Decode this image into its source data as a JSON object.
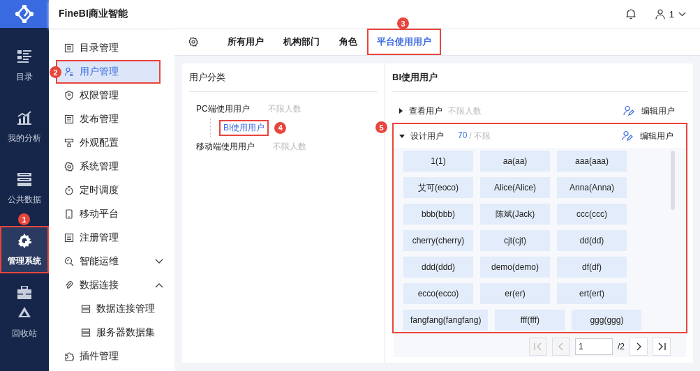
{
  "header": {
    "title": "FineBI商业智能",
    "user": "1"
  },
  "rail": [
    {
      "label": "目录",
      "selected": false
    },
    {
      "label": "我的分析",
      "selected": false
    },
    {
      "label": "公共数据",
      "selected": false
    },
    {
      "label": "管理系统",
      "selected": true,
      "callout": "1"
    },
    {
      "label": "回收站",
      "selected": false
    }
  ],
  "menu": [
    {
      "label": "目录管理",
      "selected": false
    },
    {
      "label": "用户管理",
      "selected": true,
      "callout": "2"
    },
    {
      "label": "权限管理",
      "selected": false
    },
    {
      "label": "发布管理",
      "selected": false
    },
    {
      "label": "外观配置",
      "selected": false
    },
    {
      "label": "系统管理",
      "selected": false
    },
    {
      "label": "定时调度",
      "selected": false
    },
    {
      "label": "移动平台",
      "selected": false
    },
    {
      "label": "注册管理",
      "selected": false
    },
    {
      "label": "智能运维",
      "selected": false,
      "expanded": false
    },
    {
      "label": "数据连接",
      "selected": false,
      "expanded": true,
      "children": [
        {
          "label": "数据连接管理",
          "selected": false
        },
        {
          "label": "服务器数据集",
          "selected": false
        }
      ]
    },
    {
      "label": "插件管理",
      "selected": false
    }
  ],
  "tabs": [
    {
      "label": "所有用户",
      "selected": false
    },
    {
      "label": "机构部门",
      "selected": false
    },
    {
      "label": "角色",
      "selected": false
    },
    {
      "label": "平台使用用户",
      "selected": true,
      "callout": "3"
    }
  ],
  "categories": {
    "title": "用户分类",
    "items": [
      {
        "label": "PC端使用用户",
        "note": "不限人数",
        "selected": false,
        "children": [
          {
            "label": "BI使用用户",
            "selected": true,
            "callout": "4"
          }
        ]
      },
      {
        "label": "移动端使用用户",
        "note": "不限人数",
        "selected": false
      }
    ]
  },
  "detail": {
    "title": "BI使用用户",
    "groups": [
      {
        "label": "查看用户",
        "expanded": false,
        "note": "不限人数",
        "action": "编辑用户"
      },
      {
        "label": "设计用户",
        "expanded": true,
        "count": "70",
        "limit": "/ 不限",
        "action": "编辑用户",
        "callout": "5",
        "users": [
          "1(1)",
          "aa(aa)",
          "aaa(aaa)",
          "艾可(eoco)",
          "Alice(Alice)",
          "Anna(Anna)",
          "bbb(bbb)",
          "陈斌(Jack)",
          "ccc(ccc)",
          "cherry(cherry)",
          "cjt(cjt)",
          "dd(dd)",
          "ddd(ddd)",
          "demo(demo)",
          "df(df)",
          "ecco(ecco)",
          "er(er)",
          "ert(ert)",
          "fangfang(fangfang)",
          "fff(fff)",
          "ggg(ggg)"
        ]
      }
    ]
  },
  "pagination": {
    "page": "1",
    "total": "/2"
  }
}
